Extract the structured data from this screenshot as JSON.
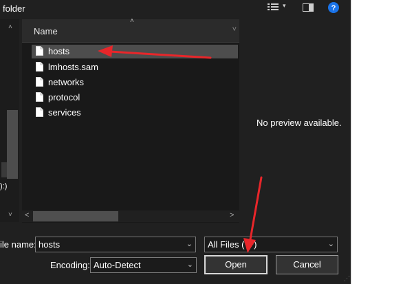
{
  "window": {
    "title": "folder"
  },
  "toolbar": {
    "view_icon": "list-view-icon",
    "dropdown_icon": "chevron-down-icon",
    "pane_icon": "preview-pane-icon",
    "help_icon": "help-icon",
    "help_symbol": "?"
  },
  "navpane": {
    "truncated_label": "):)"
  },
  "filelist": {
    "column_header": "Name",
    "items": [
      {
        "name": "hosts",
        "selected": true
      },
      {
        "name": "lmhosts.sam",
        "selected": false
      },
      {
        "name": "networks",
        "selected": false
      },
      {
        "name": "protocol",
        "selected": false
      },
      {
        "name": "services",
        "selected": false
      }
    ]
  },
  "preview": {
    "message": "No preview available."
  },
  "footer": {
    "filename_label": "ile name:",
    "filename_value": "hosts",
    "filetype_value": "All Files  (*.*)",
    "encoding_label": "Encoding:",
    "encoding_value": "Auto-Detect",
    "open_button": "Open",
    "cancel_button": "Cancel"
  },
  "annotations": {
    "arrow_color": "#e8262a"
  }
}
